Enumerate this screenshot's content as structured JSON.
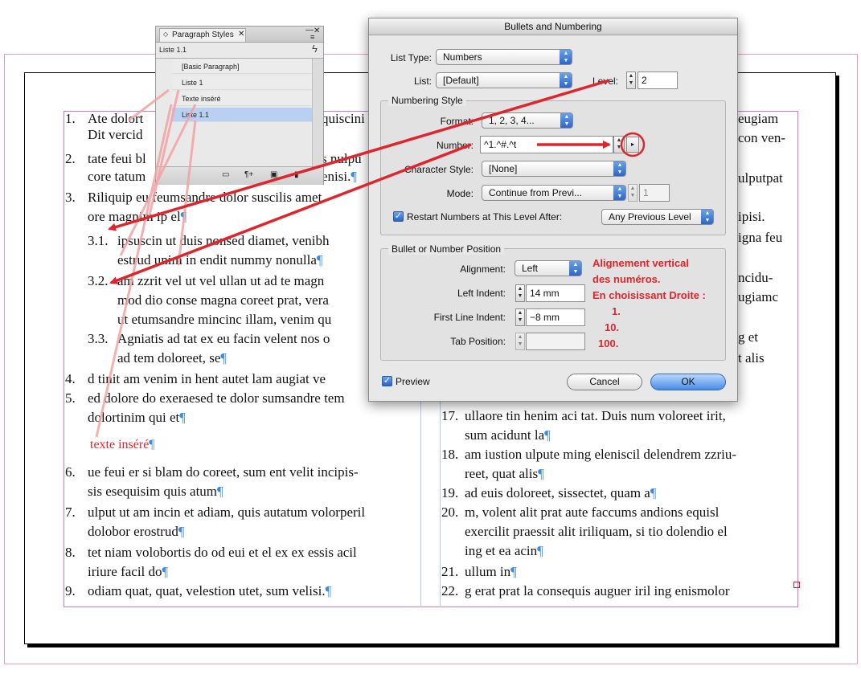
{
  "document": {
    "left_column": [
      {
        "num": "1.",
        "lines": [
          "Ate dolort",
          "Dit vercid"
        ]
      },
      {
        "num": "2.",
        "lines": [
          "tate feui bl",
          "core tatum"
        ]
      },
      {
        "num": "3.",
        "lines": [
          "Riliquip eu feumsandre dolor suscilis amet",
          "ore magnim ip el"
        ]
      },
      {
        "num": "3.1.",
        "lines": [
          "ipsuscin ut duis nonsed diamet, venibh",
          "estrud unim in endit nummy nonulla"
        ]
      },
      {
        "num": "3.2.",
        "lines": [
          "am zzrit vel ut vel ullan ut ad te magn",
          "mod dio conse magna coreet prat, vera",
          "ut etumsandre mincinc illam, venim qu"
        ]
      },
      {
        "num": "3.3.",
        "lines": [
          "Agniatis ad tat ex eu facin velent nos o",
          "ad tem doloreet, se"
        ]
      },
      {
        "num": "4.",
        "lines": [
          "d tinit am venim in hent autet lam augiat ve"
        ]
      },
      {
        "num": "5.",
        "lines": [
          "ed dolore do exeraesed te dolor sumsandre tem",
          "dolortinim qui et"
        ]
      },
      {
        "num": "",
        "lines": [
          "texte inséré"
        ]
      },
      {
        "num": "6.",
        "lines": [
          "ue feui er si blam do coreet, sum ent velit incipis-",
          "sis esequisim quis atum"
        ]
      },
      {
        "num": "7.",
        "lines": [
          "ulput ut am incin et adiam, quis autatum volorperil",
          "dolobor erostrud"
        ]
      },
      {
        "num": "8.",
        "lines": [
          "tet niam volobortis do od eui et el ex ex essis acil",
          "iriure facil do"
        ]
      },
      {
        "num": "9.",
        "lines": [
          "odiam quat, quat, velestion utet, sum velisi."
        ]
      }
    ],
    "left_fragments": [
      "s nulpu",
      "enisi.",
      "quiscini"
    ],
    "right_fragments": [
      "eugiam",
      "con ven-",
      "ulputpat",
      "ipisi.",
      "igna feu",
      "ncidu-",
      "ugiamc",
      "g et",
      "t alis"
    ],
    "right_column": [
      {
        "num": "17.",
        "lines": [
          "ullaore tin henim aci tat. Duis num voloreet irit,",
          "sum acidunt la"
        ]
      },
      {
        "num": "18.",
        "lines": [
          "am iustion ulpute ming eleniscil delendrem zzriu-",
          "reet, quat alis"
        ]
      },
      {
        "num": "19.",
        "lines": [
          "ad euis doloreet, sissectet, quam a"
        ]
      },
      {
        "num": "20.",
        "lines": [
          "m, volent alit prat aute faccums andions equisl",
          "exercilit praessit alit iriliquam, si tio dolendio el",
          "ing et ea acin"
        ]
      },
      {
        "num": "21.",
        "lines": [
          "ullum in"
        ]
      },
      {
        "num": "22.",
        "lines": [
          "g erat prat la consequis auguer iril ing enismolor"
        ]
      }
    ],
    "pilcrow": "¶"
  },
  "paragraph_styles_panel": {
    "tab_label": "Paragraph Styles",
    "current_style": "Liste 1.1",
    "styles": [
      "[Basic Paragraph]",
      "Liste 1",
      "Texte inséré",
      "Liste 1.1"
    ],
    "selected_style": "Liste 1.1"
  },
  "dialog": {
    "title": "Bullets and Numbering",
    "list_type_label": "List Type:",
    "list_type_value": "Numbers",
    "list_label": "List:",
    "list_value": "[Default]",
    "level_label": "Level:",
    "level_value": "2",
    "numbering_style_title": "Numbering Style",
    "format_label": "Format:",
    "format_value": "1, 2, 3, 4...",
    "number_label": "Number:",
    "number_value": "^1.^#.^t",
    "char_style_label": "Character Style:",
    "char_style_value": "[None]",
    "mode_label": "Mode:",
    "mode_value": "Continue from Previ...",
    "mode_number": "1",
    "restart_label": "Restart Numbers at This Level After:",
    "restart_checked": true,
    "restart_value": "Any Previous Level",
    "position_title": "Bullet or Number Position",
    "alignment_label": "Alignment:",
    "alignment_value": "Left",
    "left_indent_label": "Left Indent:",
    "left_indent_value": "14 mm",
    "first_line_label": "First Line Indent:",
    "first_line_value": "−8 mm",
    "tab_position_label": "Tab Position:",
    "tab_position_value": "",
    "preview_label": "Preview",
    "preview_checked": true,
    "cancel_label": "Cancel",
    "ok_label": "OK"
  },
  "annotation": {
    "lines": [
      "Alignement vertical",
      "des numéros.",
      "En choisissant Droite :",
      "1.",
      "10.",
      "100."
    ],
    "color": "#e0242c"
  }
}
